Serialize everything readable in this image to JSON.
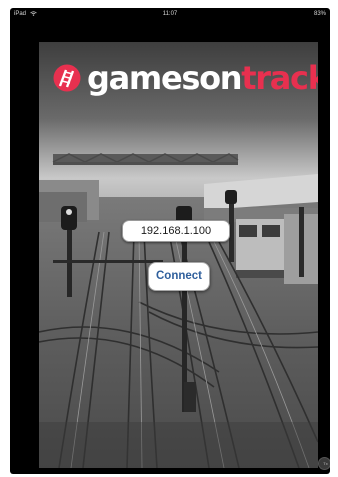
{
  "status_bar": {
    "carrier": "iPad",
    "wifi_icon": "wifi-icon",
    "time": "11:07",
    "battery": "83%"
  },
  "app": {
    "logo": {
      "part_games": "gameson",
      "part_track": "track",
      "brand_color": "#e8304f",
      "mark_icon": "train-bridge-logo-icon"
    },
    "ip_field": {
      "value": "192.168.1.100"
    },
    "connect_button": {
      "label": "Connect",
      "color": "#2f5f9c"
    }
  },
  "overlay": {
    "assistive_touch_label": "Tx"
  }
}
